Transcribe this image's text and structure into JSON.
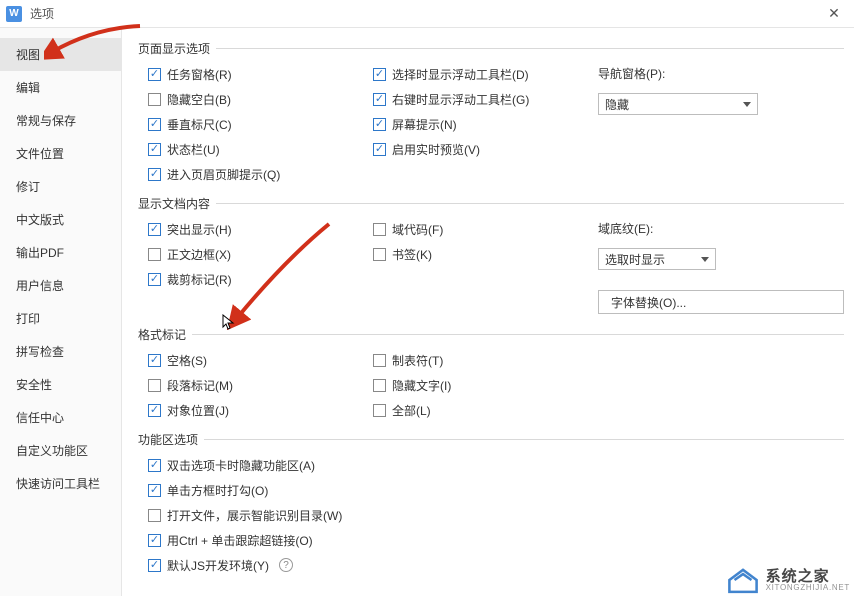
{
  "window": {
    "title": "选项"
  },
  "sidebar": {
    "items": [
      {
        "label": "视图",
        "active": true
      },
      {
        "label": "编辑",
        "active": false
      },
      {
        "label": "常规与保存",
        "active": false
      },
      {
        "label": "文件位置",
        "active": false
      },
      {
        "label": "修订",
        "active": false
      },
      {
        "label": "中文版式",
        "active": false
      },
      {
        "label": "输出PDF",
        "active": false
      },
      {
        "label": "用户信息",
        "active": false
      },
      {
        "label": "打印",
        "active": false
      },
      {
        "label": "拼写检查",
        "active": false
      },
      {
        "label": "安全性",
        "active": false
      },
      {
        "label": "信任中心",
        "active": false
      },
      {
        "label": "自定义功能区",
        "active": false
      },
      {
        "label": "快速访问工具栏",
        "active": false
      }
    ]
  },
  "groups": {
    "page": {
      "legend": "页面显示选项",
      "col1": [
        {
          "label": "任务窗格(R)",
          "checked": true
        },
        {
          "label": "隐藏空白(B)",
          "checked": false
        },
        {
          "label": "垂直标尺(C)",
          "checked": true
        },
        {
          "label": "状态栏(U)",
          "checked": true
        },
        {
          "label": "进入页眉页脚提示(Q)",
          "checked": true
        }
      ],
      "col2": [
        {
          "label": "选择时显示浮动工具栏(D)",
          "checked": true
        },
        {
          "label": "右键时显示浮动工具栏(G)",
          "checked": true
        },
        {
          "label": "屏幕提示(N)",
          "checked": true
        },
        {
          "label": "启用实时预览(V)",
          "checked": true
        }
      ],
      "nav": {
        "label": "导航窗格(P):",
        "select_value": "隐藏"
      }
    },
    "doc": {
      "legend": "显示文档内容",
      "col1": [
        {
          "label": "突出显示(H)",
          "checked": true
        },
        {
          "label": "正文边框(X)",
          "checked": false
        },
        {
          "label": "裁剪标记(R)",
          "checked": true
        }
      ],
      "col2": [
        {
          "label": "域代码(F)",
          "checked": false
        },
        {
          "label": "书签(K)",
          "checked": false
        }
      ],
      "shade": {
        "label": "域底纹(E):",
        "select_value": "选取时显示"
      },
      "font_btn": "字体替换(O)..."
    },
    "marks": {
      "legend": "格式标记",
      "col1": [
        {
          "label": "空格(S)",
          "checked": true
        },
        {
          "label": "段落标记(M)",
          "checked": false
        },
        {
          "label": "对象位置(J)",
          "checked": true
        }
      ],
      "col2": [
        {
          "label": "制表符(T)",
          "checked": false
        },
        {
          "label": "隐藏文字(I)",
          "checked": false
        },
        {
          "label": "全部(L)",
          "checked": false
        }
      ]
    },
    "ribbon": {
      "legend": "功能区选项",
      "items": [
        {
          "label": "双击选项卡时隐藏功能区(A)",
          "checked": true
        },
        {
          "label": "单击方框时打勾(O)",
          "checked": true
        },
        {
          "label": "打开文件，展示智能识别目录(W)",
          "checked": false
        },
        {
          "label": "用Ctrl + 单击跟踪超链接(O)",
          "checked": true
        },
        {
          "label": "默认JS开发环境(Y)",
          "checked": true,
          "info": true
        }
      ]
    }
  },
  "watermark": {
    "cn": "系统之家",
    "en": "XITONGZHIJIA.NET"
  }
}
